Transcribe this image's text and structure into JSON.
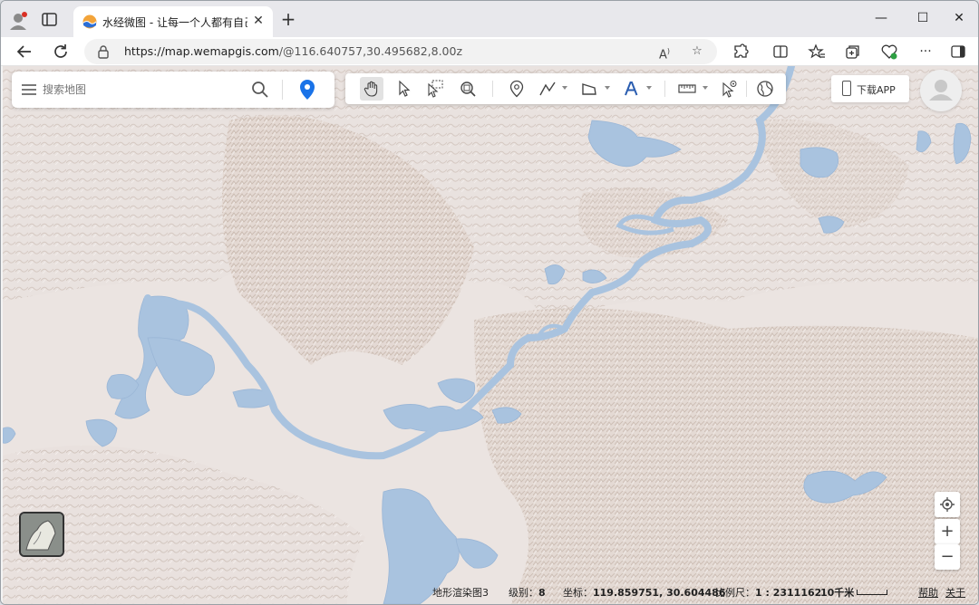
{
  "browser": {
    "tab_title": "水经微图 - 让每一个人都有自己的",
    "url_host": "https://map.wemapgis.com",
    "url_path": "/@116.640757,30.495682,8.00z",
    "new_tab": "+",
    "close_tab": "✕",
    "minimize": "—",
    "maximize": "☐",
    "close_window": "✕"
  },
  "search": {
    "placeholder": "搜索地图"
  },
  "download": {
    "label": "下载APP"
  },
  "status": {
    "layer_name": "地形渲染图3",
    "level_label": "级别：",
    "level_value": "8",
    "coord_label": "坐标：",
    "coord_value": "119.859751, 30.604486",
    "scale_label": "比例尺：",
    "scale_value": "1 : 2311162",
    "scale_bar_label": "10千米",
    "help": "帮助",
    "about": "关于"
  },
  "zoom": {
    "in": "+",
    "out": "−"
  },
  "colors": {
    "water": "#a9c3df",
    "terrain": "#e8e0dc",
    "accent": "#1a73e8"
  }
}
